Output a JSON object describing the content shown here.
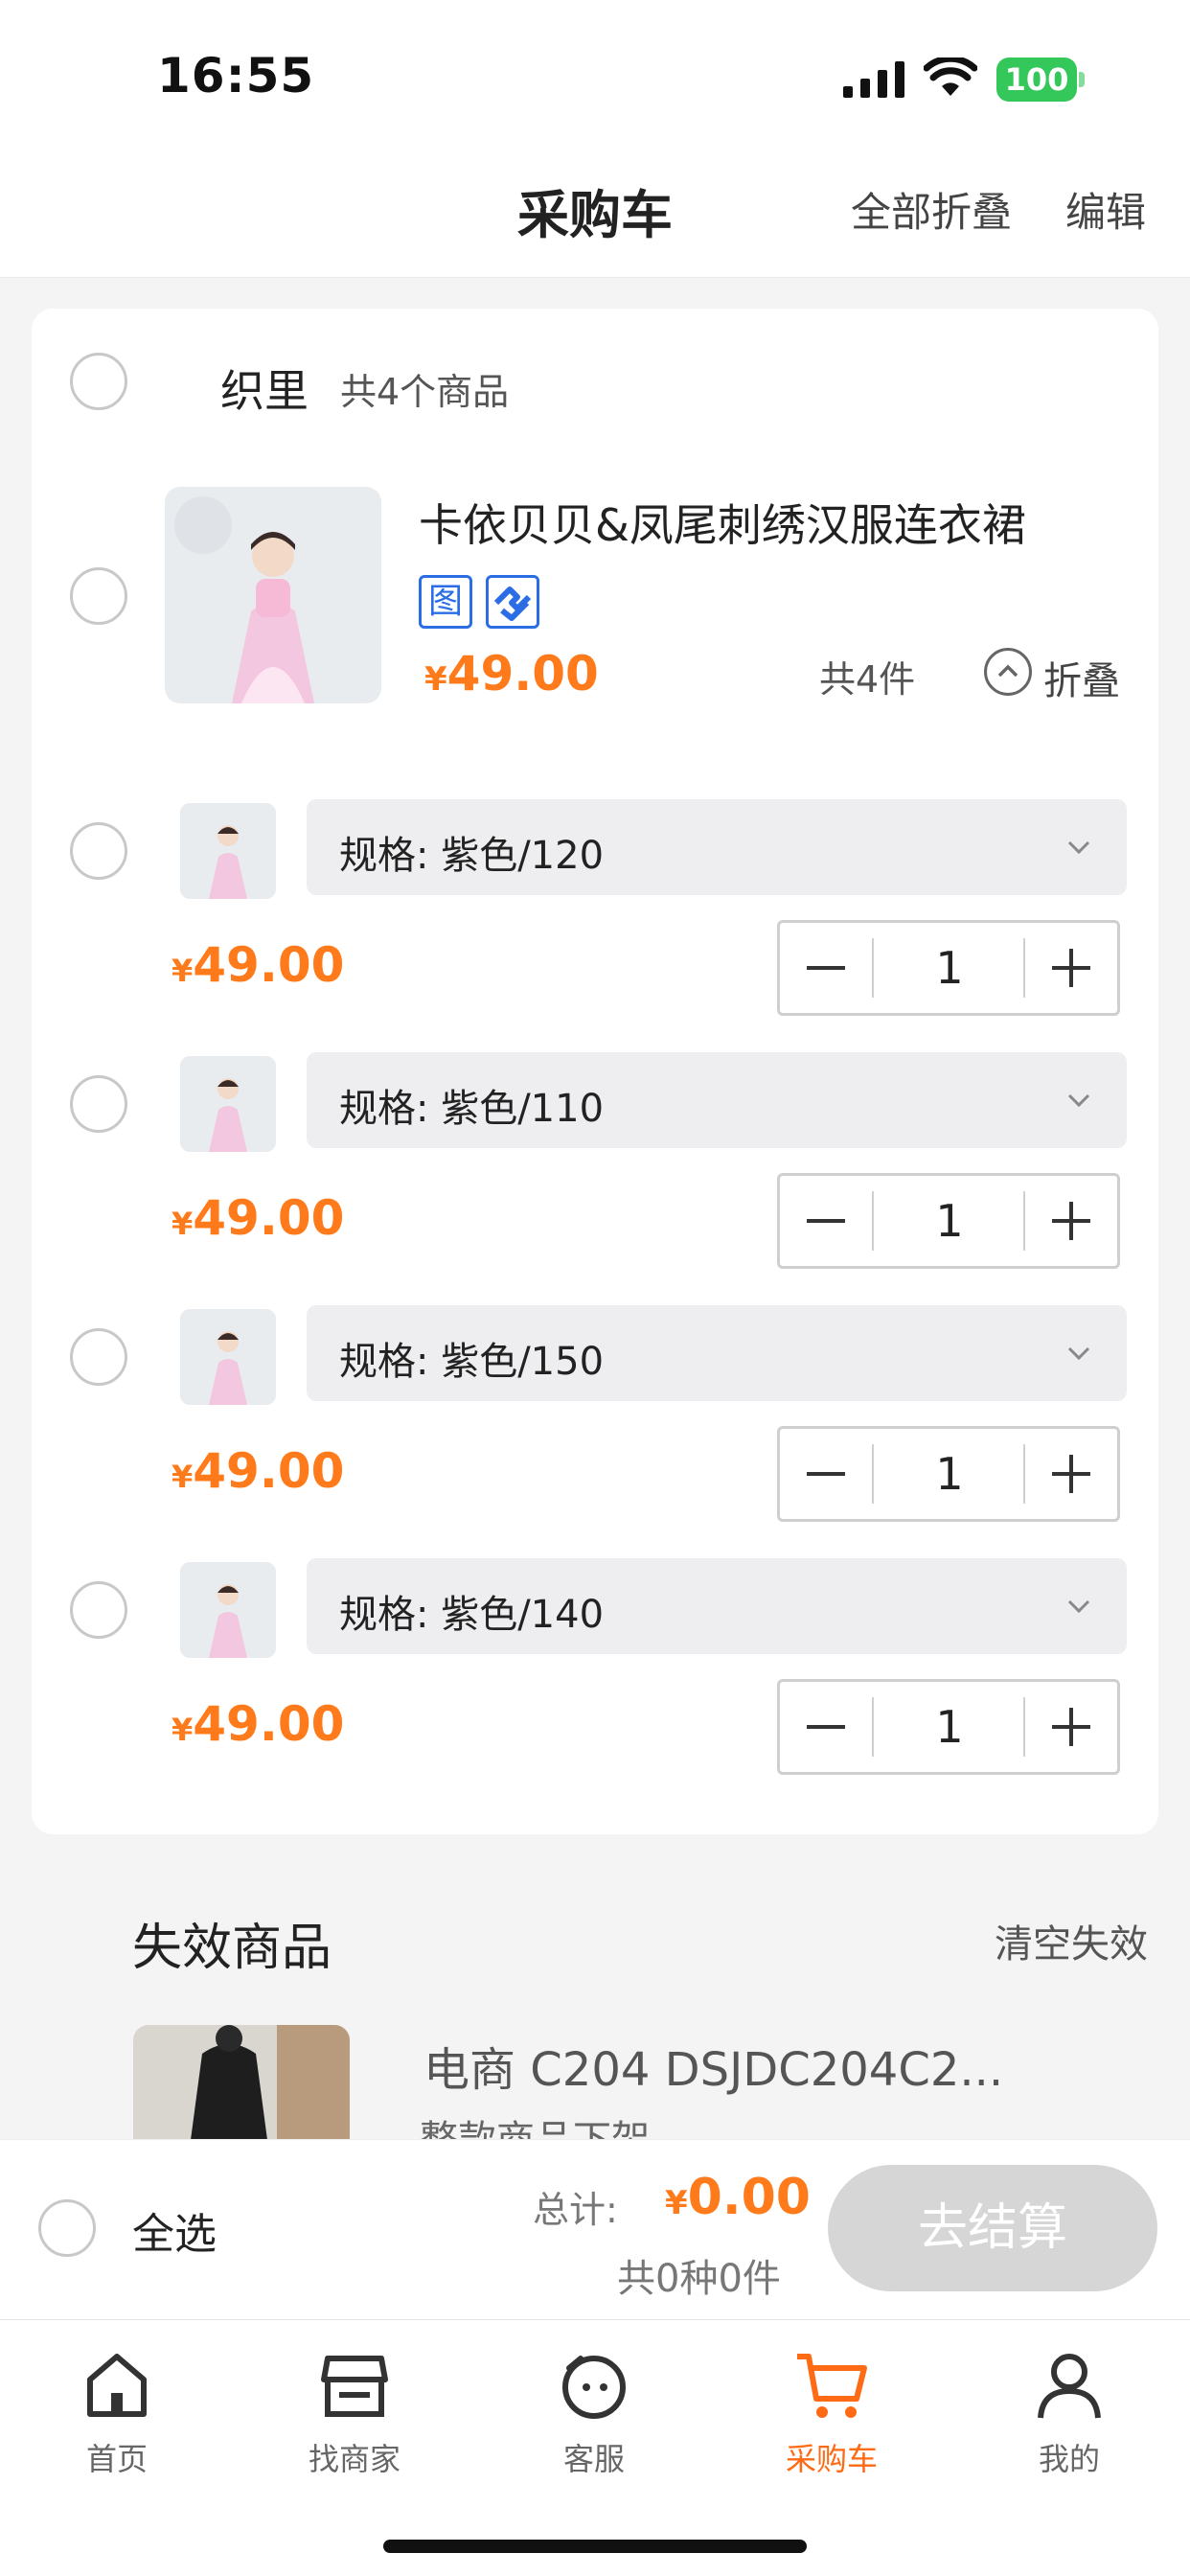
{
  "status_bar": {
    "time": "16:55",
    "battery": "100"
  },
  "header": {
    "title": "采购车",
    "fold_all": "全部折叠",
    "edit": "编辑"
  },
  "shop": {
    "name": "织里",
    "count": "共4个商品",
    "product": {
      "title": "卡依贝贝&凤尾刺绣汉服连衣裙",
      "tag_image": "图",
      "price_currency": "¥",
      "price": "49.00",
      "total_pieces": "共4件",
      "fold_label": "折叠"
    },
    "variants": [
      {
        "spec": "规格: 紫色/120",
        "currency": "¥",
        "price": "49.00",
        "qty": "1"
      },
      {
        "spec": "规格: 紫色/110",
        "currency": "¥",
        "price": "49.00",
        "qty": "1"
      },
      {
        "spec": "规格: 紫色/150",
        "currency": "¥",
        "price": "49.00",
        "qty": "1"
      },
      {
        "spec": "规格: 紫色/140",
        "currency": "¥",
        "price": "49.00",
        "qty": "1"
      }
    ]
  },
  "invalid": {
    "title": "失效商品",
    "clear": "清空失效",
    "item": {
      "name": "电商 C204 DSJDC204C2...",
      "reason": "整款商品下架"
    }
  },
  "checkout": {
    "select_all": "全选",
    "total_label": "总计:",
    "total_currency": "¥",
    "total_value": "0.00",
    "count": "共0种0件",
    "pay_button": "去结算"
  },
  "tabbar": [
    {
      "label": "首页",
      "icon": "home-icon"
    },
    {
      "label": "找商家",
      "icon": "store-icon"
    },
    {
      "label": "客服",
      "icon": "service-icon"
    },
    {
      "label": "采购车",
      "icon": "cart-icon",
      "active": true
    },
    {
      "label": "我的",
      "icon": "user-icon"
    }
  ],
  "colors": {
    "accent": "#ff7a1a",
    "tag_blue": "#2a6de5",
    "battery": "#34c759"
  }
}
